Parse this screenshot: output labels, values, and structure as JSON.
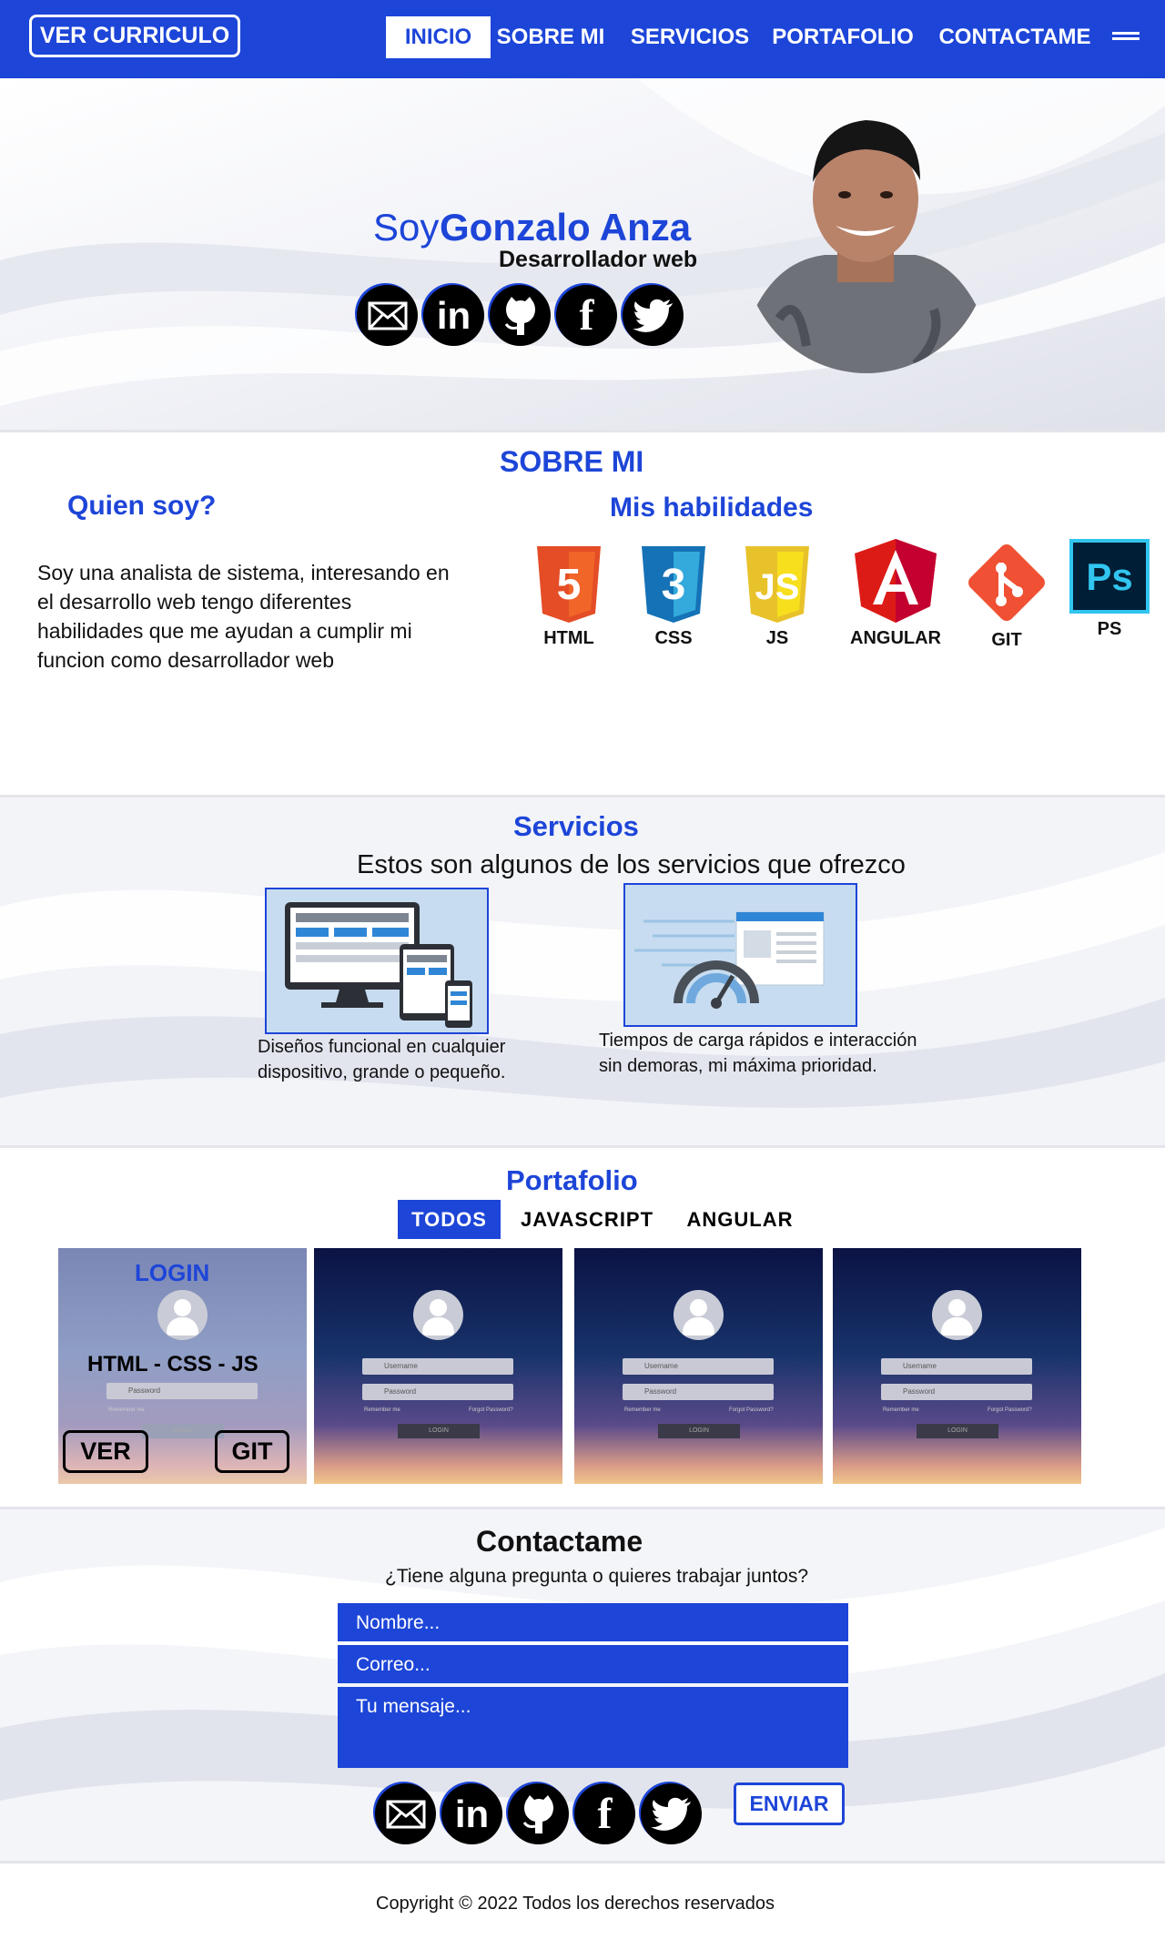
{
  "nav": {
    "cv_button": "VER CURRICULO",
    "items": [
      "INICIO",
      "SOBRE MI",
      "SERVICIOS",
      "PORTAFOLIO",
      "CONTACTAME"
    ],
    "active": "INICIO",
    "menu_icon": "hamburger-icon"
  },
  "hero": {
    "prefix": "Soy",
    "name": "Gonzalo Anza",
    "role": "Desarrollador web",
    "social_icons": [
      "mail-icon",
      "linkedin-icon",
      "github-icon",
      "facebook-icon",
      "twitter-icon"
    ],
    "linkedin_text": "in",
    "facebook_text": "f"
  },
  "about": {
    "title": "SOBRE MI",
    "who_title": "Quien soy?",
    "who_text": "Soy una analista de sistema, interesando en el desarrollo web tengo diferentes habilidades que me ayudan a cumplir mi funcion como desarrollador web",
    "skills_title": "Mis habilidades",
    "skills": [
      {
        "label": "HTML",
        "icon": "html5-icon",
        "glyph": "5",
        "color": "#e44d26"
      },
      {
        "label": "CSS",
        "icon": "css3-icon",
        "glyph": "3",
        "color": "#1572b6"
      },
      {
        "label": "JS",
        "icon": "js-icon",
        "glyph": "JS",
        "color": "#f0db4f"
      },
      {
        "label": "ANGULAR",
        "icon": "angular-icon",
        "glyph": "A",
        "color": "#dd1b16"
      },
      {
        "label": "GIT",
        "icon": "git-icon",
        "glyph": "",
        "color": "#f05033"
      },
      {
        "label": "PS",
        "icon": "photoshop-icon",
        "glyph": "Ps",
        "color": "#001e36"
      }
    ]
  },
  "services": {
    "title": "Servicios",
    "subtitle": "Estos son algunos de los servicios que ofrezco",
    "items": [
      {
        "icon": "responsive-devices-icon",
        "caption_line1": "Diseños funcional en cualquier",
        "caption_line2": "dispositivo, grande o pequeño."
      },
      {
        "icon": "speed-gauge-icon",
        "caption_line1": "Tiempos de carga rápidos e interacción",
        "caption_line2": "sin demoras, mi máxima prioridad."
      }
    ]
  },
  "portfolio": {
    "title": "Portafolio",
    "tabs": [
      "TODOS",
      "JAVASCRIPT",
      "ANGULAR"
    ],
    "active_tab": "TODOS",
    "hover_card": {
      "title": "LOGIN",
      "tech": "HTML - CSS - JS",
      "view_button": "VER",
      "git_button": "GIT"
    },
    "card_fields": {
      "username": "Username",
      "password": "Password",
      "remember": "Remember me",
      "forgot": "Forgot Password?",
      "login": "LOGIN"
    }
  },
  "contact": {
    "title": "Contactame",
    "subtitle": "¿Tiene alguna pregunta o quieres trabajar juntos?",
    "name_placeholder": "Nombre...",
    "email_placeholder": "Correo...",
    "message_placeholder": "Tu mensaje...",
    "send_button": "ENVIAR"
  },
  "footer": {
    "copyright": "Copyright © 2022 Todos los derechos reservados"
  },
  "colors": {
    "brand": "#1d45d8",
    "text": "#111111",
    "card_bg": "#c7dcf0"
  }
}
